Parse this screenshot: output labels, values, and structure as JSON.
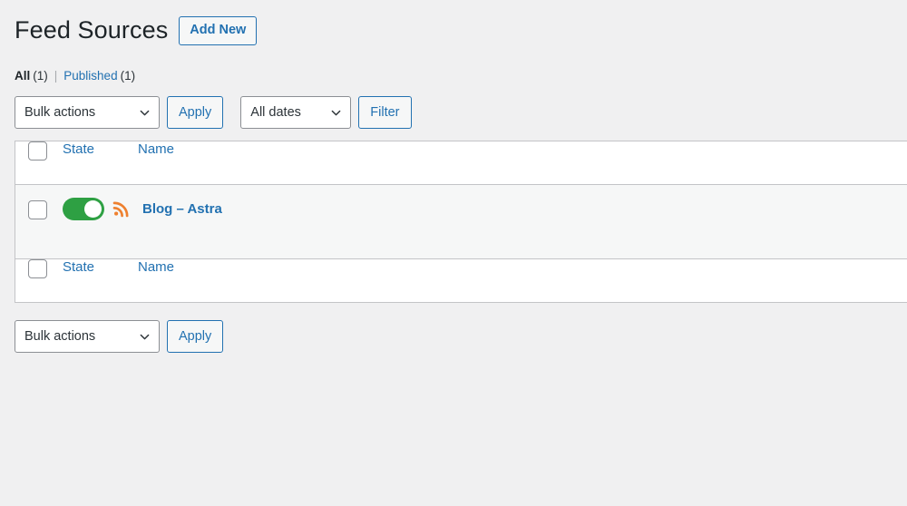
{
  "header": {
    "title": "Feed Sources",
    "add_new_label": "Add New"
  },
  "status_links": {
    "all": {
      "label": "All",
      "count": "(1)"
    },
    "separator": "|",
    "published": {
      "label": "Published",
      "count": "(1)"
    }
  },
  "tablenav_top": {
    "bulk_actions_value": "Bulk actions",
    "bulk_actions_options": [
      "Bulk actions"
    ],
    "apply_label": "Apply",
    "dates_value": "All dates",
    "dates_options": [
      "All dates"
    ],
    "filter_label": "Filter"
  },
  "tablenav_bottom": {
    "bulk_actions_value": "Bulk actions",
    "bulk_actions_options": [
      "Bulk actions"
    ],
    "apply_label": "Apply"
  },
  "table": {
    "columns": {
      "state": "State",
      "name": "Name"
    },
    "rows": [
      {
        "state_toggle": "on",
        "feed_icon": "rss-icon",
        "name": "Blog – Astra"
      }
    ]
  },
  "colors": {
    "page_background": "#f0f0f1",
    "link": "#2271b1",
    "toggle_on": "#2ea043",
    "rss_orange": "#ee802f",
    "row_background": "#f6f7f7",
    "border": "#c3c4c7",
    "heading_text": "#1d2327"
  }
}
